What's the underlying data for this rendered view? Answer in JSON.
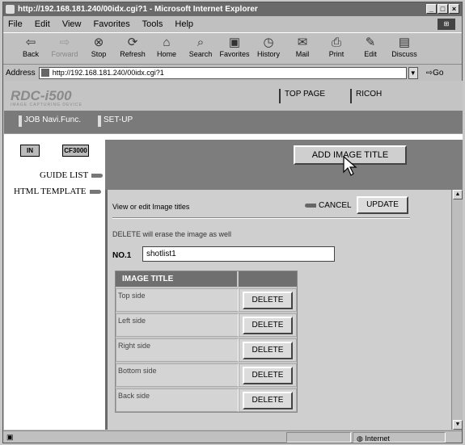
{
  "window": {
    "title": "http://192.168.181.240/00idx.cgi?1 - Microsoft Internet Explorer",
    "min": "_",
    "max": "□",
    "close": "×"
  },
  "menu": [
    "File",
    "Edit",
    "View",
    "Favorites",
    "Tools",
    "Help"
  ],
  "toolbar": [
    {
      "label": "Back",
      "icon": "back-arrow-icon",
      "glyph": "⇦"
    },
    {
      "label": "Forward",
      "icon": "forward-arrow-icon",
      "glyph": "⇨"
    },
    {
      "label": "Stop",
      "icon": "stop-icon",
      "glyph": "⊗"
    },
    {
      "label": "Refresh",
      "icon": "refresh-icon",
      "glyph": "⟳"
    },
    {
      "label": "Home",
      "icon": "home-icon",
      "glyph": "⌂"
    },
    {
      "label": "Search",
      "icon": "search-icon",
      "glyph": "⌕"
    },
    {
      "label": "Favorites",
      "icon": "favorites-icon",
      "glyph": "▣"
    },
    {
      "label": "History",
      "icon": "history-icon",
      "glyph": "◷"
    },
    {
      "label": "Mail",
      "icon": "mail-icon",
      "glyph": "✉"
    },
    {
      "label": "Print",
      "icon": "print-icon",
      "glyph": "⎙"
    },
    {
      "label": "Edit",
      "icon": "edit-icon",
      "glyph": "✎"
    },
    {
      "label": "Discuss",
      "icon": "discuss-icon",
      "glyph": "▤"
    }
  ],
  "address": {
    "label": "Address",
    "url": "http://192.168.181.240/00idx.cgi?1",
    "go": "Go"
  },
  "page": {
    "logo": "RDC-i500",
    "logo_sub": "IMAGE CAPTURING DEVICE",
    "top_page": "TOP PAGE",
    "ricoh": "RICOH",
    "tab_job": "JOB Navi.Func.",
    "tab_setup": "SET-UP",
    "btn_in": "IN",
    "btn_cf": "CF3000",
    "guide_list": "GUIDE LIST",
    "html_template": "HTML TEMPLATE",
    "add_image_title": "ADD IMAGE TITLE",
    "view_edit": "View or edit Image titles",
    "cancel": "CANCEL",
    "update": "UPDATE",
    "delete_note": "DELETE will erase the image as well",
    "no_label": "NO.1",
    "no_value": "shotlist1",
    "table_header": "IMAGE TITLE",
    "rows": [
      {
        "title": "Top side",
        "btn": "DELETE"
      },
      {
        "title": "Left side",
        "btn": "DELETE"
      },
      {
        "title": "Right side",
        "btn": "DELETE"
      },
      {
        "title": "Bottom side",
        "btn": "DELETE"
      },
      {
        "title": "Back side",
        "btn": "DELETE"
      }
    ]
  },
  "status": {
    "zone": "Internet"
  }
}
